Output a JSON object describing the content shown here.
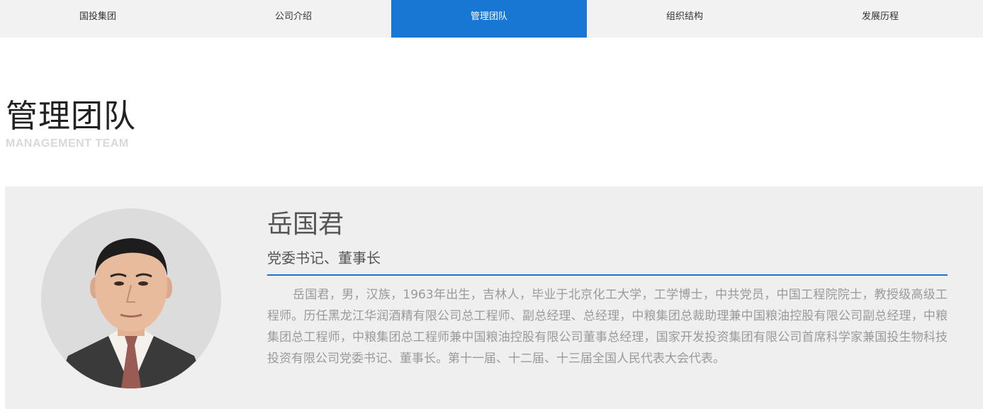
{
  "nav": {
    "items": [
      {
        "label": "国投集团"
      },
      {
        "label": "公司介绍"
      },
      {
        "label": "管理团队"
      },
      {
        "label": "组织结构"
      },
      {
        "label": "发展历程"
      }
    ],
    "active_index": 2
  },
  "heading": {
    "title": "管理团队",
    "subtitle": "MANAGEMENT TEAM"
  },
  "profile": {
    "name": "岳国君",
    "position": "党委书记、董事长",
    "bio": "岳国君，男，汉族，1963年出生，吉林人，毕业于北京化工大学，工学博士，中共党员，中国工程院院士，教授级高级工程师。历任黑龙江华润酒精有限公司总工程师、副总经理、总经理，中粮集团总裁助理兼中国粮油控股有限公司副总经理，中粮集团总工程师，中粮集团总工程师兼中国粮油控股有限公司董事总经理，国家开发投资集团有限公司首席科学家兼国投生物科技投资有限公司党委书记、董事长。第十一届、十二届、十三届全国人民代表大会代表。"
  },
  "colors": {
    "accent": "#1777d2",
    "nav_bg": "#f2f2f2",
    "card_bg": "#efefef"
  }
}
